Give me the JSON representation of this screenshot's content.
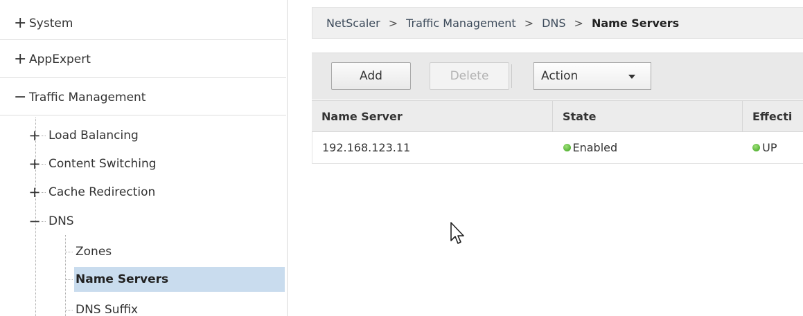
{
  "sidebar": {
    "top_items": [
      {
        "sign": "+",
        "label": "System"
      },
      {
        "sign": "+",
        "label": "AppExpert"
      },
      {
        "sign": "−",
        "label": "Traffic Management"
      }
    ],
    "sub_items": [
      {
        "sign": "+",
        "label": "Load Balancing"
      },
      {
        "sign": "+",
        "label": "Content Switching"
      },
      {
        "sign": "+",
        "label": "Cache Redirection"
      },
      {
        "sign": "−",
        "label": "DNS"
      }
    ],
    "dns_children": [
      {
        "label": "Zones"
      },
      {
        "label": "Name Servers",
        "selected": true
      },
      {
        "label": "DNS Suffix"
      }
    ]
  },
  "breadcrumb": {
    "items": [
      "NetScaler",
      "Traffic Management",
      "DNS"
    ],
    "current": "Name Servers",
    "separator": ">"
  },
  "toolbar": {
    "add_label": "Add",
    "delete_label": "Delete",
    "action_label": "Action"
  },
  "table": {
    "columns": [
      "Name Server",
      "State",
      "Effecti"
    ],
    "rows": [
      {
        "name_server": "192.168.123.11",
        "state": "Enabled",
        "effective": "UP"
      }
    ]
  },
  "colors": {
    "selected_bg": "#c9dcee",
    "status_green": "#39a21b"
  },
  "icons": {
    "cursor": "mouse-pointer-icon",
    "status": "green-dot-icon"
  }
}
